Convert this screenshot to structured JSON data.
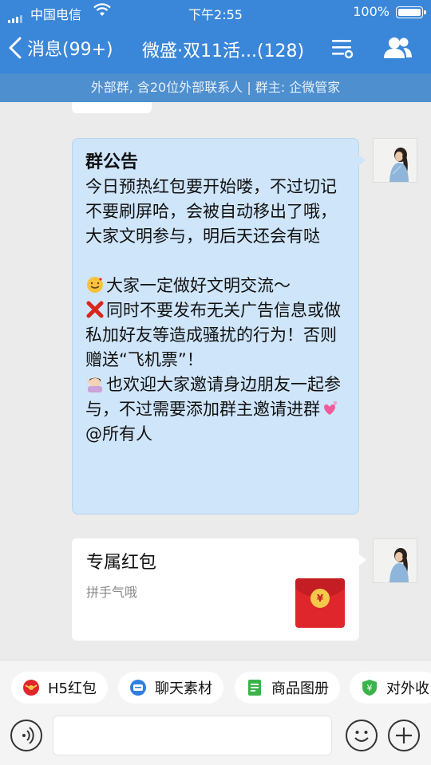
{
  "status_bar": {
    "carrier": "中国电信",
    "time": "下午2:55",
    "battery": "100%"
  },
  "nav": {
    "back_label": "消息(99+)",
    "title": "微盛·双11活...(128)"
  },
  "subbar": {
    "info": "外部群, 含20位外部联系人 | 群主: 企微管家"
  },
  "announcement": {
    "title": "群公告",
    "line1": "今日预热红包要开始喽，不过切记不要刷屏哈，会被自动移出了哦，大家文明参与，明后天还会有哒",
    "line2": "大家一定做好文明交流～",
    "line3": "同时不要发布无关广告信息或做私加好友等造成骚扰的行为！否则赠送“飞机票”！",
    "line4": "也欢迎大家邀请身边朋友一起参与，不过需要添加群主邀请进群",
    "line5": "@所有人"
  },
  "red_packet": {
    "title": "专属红包",
    "subtitle": "拼手气哦",
    "symbol": "¥"
  },
  "quick_actions": [
    {
      "label": "H5红包",
      "icon": "red-packet-icon"
    },
    {
      "label": "聊天素材",
      "icon": "chat-material-icon"
    },
    {
      "label": "商品图册",
      "icon": "catalog-icon"
    },
    {
      "label": "对外收",
      "icon": "payment-icon"
    }
  ],
  "input": {
    "placeholder": ""
  },
  "colors": {
    "nav_bg": "#3a87d9",
    "subbar_bg": "#4d8fcf",
    "announcement_bg": "#cfe5fa",
    "red_packet": "#e0262d"
  }
}
